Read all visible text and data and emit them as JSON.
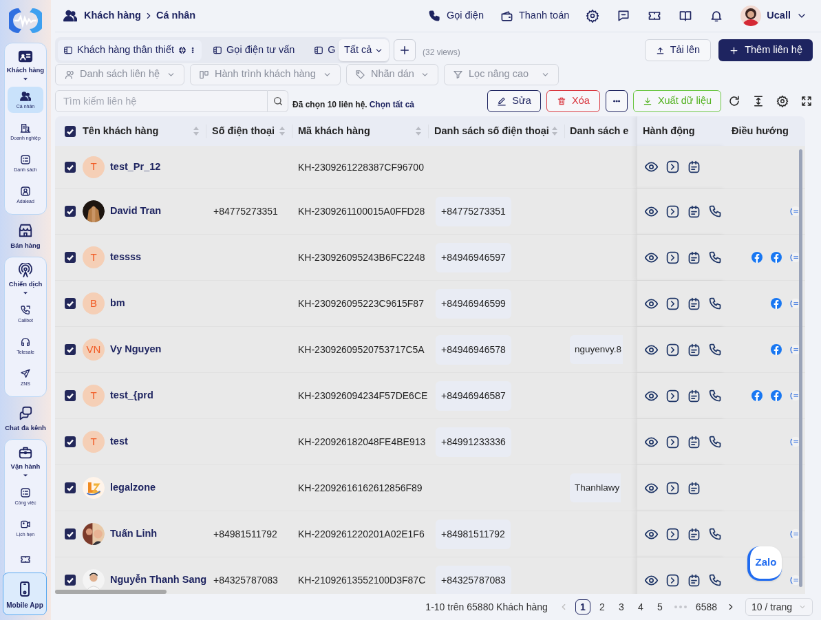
{
  "sidebar": {
    "items": [
      {
        "kind": "group",
        "label": "Khách hàng",
        "expanded": true,
        "children": [
          {
            "label": "Cá nhân",
            "selected": true
          },
          {
            "label": "Doanh nghiệp",
            "selected": false
          },
          {
            "label": "Danh sách",
            "selected": false
          },
          {
            "label": "Adalead",
            "selected": false
          }
        ]
      },
      {
        "kind": "single",
        "label": "Bán hàng"
      },
      {
        "kind": "group",
        "label": "Chiến dịch",
        "expanded": true,
        "children": [
          {
            "label": "Callbot",
            "selected": false
          },
          {
            "label": "Telesale",
            "selected": false
          },
          {
            "label": "ZNS",
            "selected": false
          }
        ]
      },
      {
        "kind": "single",
        "label": "Chat đa kênh"
      },
      {
        "kind": "group",
        "label": "Vận hành",
        "expanded": true,
        "children": [
          {
            "label": "Công việc",
            "selected": false
          },
          {
            "label": "Lịch hẹn",
            "selected": false
          },
          {
            "selected": false
          }
        ]
      }
    ],
    "mobile_app": {
      "label": "Mobile App"
    }
  },
  "breadcrumb": [
    "Khách hàng",
    "Cá nhân"
  ],
  "top_bar": {
    "actions": [
      {
        "label": "Gọi điện"
      },
      {
        "label": "Thanh toán"
      }
    ],
    "user": {
      "name": "Ucall"
    }
  },
  "view_tabs": [
    {
      "label": "Khách hàng thân thiết",
      "selected": true,
      "public": true
    },
    {
      "label": "Gọi điện tư vấn",
      "selected": false,
      "public": false
    },
    {
      "label": "G",
      "selected": false,
      "public": false
    }
  ],
  "view_picker": {
    "value": "Tất cả"
  },
  "views_count": "(32 views)",
  "upload_button": "Tải lên",
  "add_button": "Thêm liên hệ",
  "filters": [
    "Danh sách liên hệ",
    "Hành trình khách hàng",
    "Nhãn dán",
    "Lọc nâng cao"
  ],
  "search": {
    "placeholder": "Tìm kiếm liên hệ"
  },
  "selection_note": "Đã chọn 10 liên hệ.",
  "select_all_link": "Chọn tất cả",
  "bulk_actions": [
    {
      "kind": "edit",
      "label": "Sửa"
    },
    {
      "kind": "delete",
      "label": "Xóa"
    },
    {
      "kind": "more"
    },
    {
      "kind": "export",
      "label": "Xuất dữ liệu"
    }
  ],
  "table": {
    "all_checked": true,
    "columns": [
      {
        "label": "Tên khách hàng",
        "sortable": true
      },
      {
        "label": "Số điện thoại",
        "sortable": true
      },
      {
        "label": "Mã khách hàng",
        "sortable": true
      },
      {
        "label": "Danh sách số điện thoại",
        "sortable": true
      },
      {
        "label": "Danh sách e",
        "sortable": false
      },
      {
        "label": "Hành động",
        "sortable": false
      },
      {
        "label": "Điều hướng",
        "sortable": false
      }
    ],
    "rows": [
      {
        "checked": true,
        "name": "test_Pr_12",
        "avatar": {
          "kind": "initials",
          "text": "T"
        },
        "code": "KH-2309261228387CF96700",
        "phone_list": [],
        "email_list": [],
        "call": false,
        "channels": []
      },
      {
        "checked": true,
        "name": "David Tran",
        "avatar": {
          "kind": "picture"
        },
        "phone": "+84775273351",
        "code": "KH-2309261100015A0FFD28",
        "phone_list": [
          "+84775273351"
        ],
        "email_list": [],
        "call": true,
        "channels": [
          {
            "kind": "zalo"
          }
        ]
      },
      {
        "checked": true,
        "name": "tessss",
        "avatar": {
          "kind": "initials",
          "text": "T"
        },
        "code": "KH-230926095243B6FC2248",
        "phone_list": [
          "+84946946597"
        ],
        "email_list": [],
        "call": true,
        "channels": [
          {
            "kind": "facebook"
          },
          {
            "kind": "facebook"
          },
          {
            "kind": "zalo"
          }
        ]
      },
      {
        "checked": true,
        "name": "bm",
        "avatar": {
          "kind": "initials",
          "text": "B"
        },
        "code": "KH-230926095223C9615F87",
        "phone_list": [
          "+84946946599"
        ],
        "email_list": [],
        "call": true,
        "channels": [
          {
            "kind": "facebook"
          },
          {
            "kind": "zalo"
          }
        ]
      },
      {
        "checked": true,
        "name": "Vy Nguyen",
        "avatar": {
          "kind": "initials",
          "text": "VN"
        },
        "code": "KH-23092609520753717C5A",
        "phone_list": [
          "+84946946578"
        ],
        "email_list": [
          "nguyenvy.8"
        ],
        "call": true,
        "channels": [
          {
            "kind": "facebook"
          },
          {
            "kind": "zalo"
          }
        ]
      },
      {
        "checked": true,
        "name": "test_{prd",
        "avatar": {
          "kind": "initials",
          "text": "T"
        },
        "code": "KH-230926094234F57DE6CE",
        "phone_list": [
          "+84946946587"
        ],
        "email_list": [],
        "call": true,
        "channels": [
          {
            "kind": "facebook"
          },
          {
            "kind": "facebook"
          },
          {
            "kind": "zalo"
          }
        ]
      },
      {
        "checked": true,
        "name": "test",
        "avatar": {
          "kind": "initials",
          "text": "T"
        },
        "code": "KH-220926182048FE4BE913",
        "phone_list": [
          "+84991233336"
        ],
        "email_list": [],
        "call": true,
        "channels": [
          {
            "kind": "zalo"
          }
        ]
      },
      {
        "checked": true,
        "name": "legalzone",
        "avatar": {
          "kind": "picture"
        },
        "code": "KH-22092616162612856F89",
        "phone_list": [],
        "email_list": [
          "Thanhlawy"
        ],
        "call": false,
        "channels": []
      },
      {
        "checked": true,
        "name": "Tuấn Linh",
        "avatar": {
          "kind": "picture"
        },
        "phone": "+84981511792",
        "code": "KH-2209261220201A02E1F6",
        "phone_list": [
          "+84981511792"
        ],
        "email_list": [],
        "call": true,
        "channels": [
          {
            "kind": "zalo"
          }
        ]
      },
      {
        "checked": true,
        "name": "Nguyễn Thanh Sang",
        "avatar": {
          "kind": "picture"
        },
        "phone": "+84325787083",
        "code": "KH-21092613552100D3F87C",
        "phone_list": [
          "+84325787083"
        ],
        "email_list": [],
        "call": true,
        "channels": [
          {
            "kind": "zalo"
          }
        ]
      }
    ]
  },
  "pagination": {
    "summary": "1-10 trên 65880 Khách hàng",
    "pages": [
      {
        "label": "1",
        "selected": true
      },
      {
        "label": "2",
        "selected": false
      },
      {
        "label": "3",
        "selected": false
      },
      {
        "label": "4",
        "selected": false
      },
      {
        "label": "5",
        "selected": false
      },
      {
        "kind": "gap"
      },
      {
        "label": "6588",
        "selected": false
      }
    ],
    "page_size": "10 / trang"
  },
  "floating_chat": {
    "label": "Zalo"
  }
}
